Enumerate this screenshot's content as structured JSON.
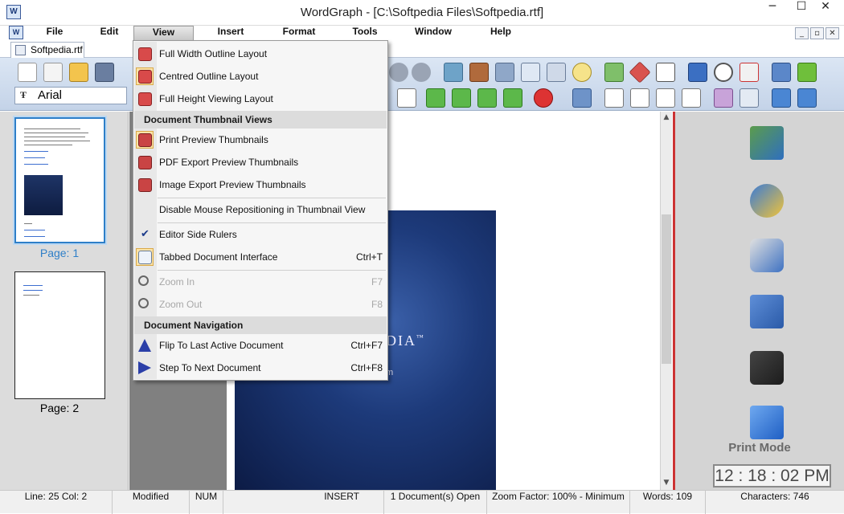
{
  "window": {
    "title": "WordGraph - [C:\\Softpedia Files\\Softpedia.rtf]",
    "min_glyph": "─",
    "max_glyph": "☐",
    "close_glyph": "✕"
  },
  "menubar": {
    "items": [
      "File",
      "Edit",
      "View",
      "Insert",
      "Format",
      "Tools",
      "Window",
      "Help"
    ],
    "active": "View"
  },
  "mdi_buttons": [
    "_",
    "▫",
    "✕"
  ],
  "tab": {
    "label": "Softpedia.rtf"
  },
  "font_box": {
    "value": "Arial",
    "icon_glyph": "Ŧ"
  },
  "thumbnails": [
    {
      "label": "Page: 1",
      "selected": true
    },
    {
      "label": "Page: 2",
      "selected": false
    }
  ],
  "view_menu": {
    "items": [
      {
        "label": "Full Width Outline Layout",
        "shortcut": ""
      },
      {
        "label": "Centred Outline Layout",
        "shortcut": ""
      },
      {
        "label": "Full Height Viewing Layout",
        "shortcut": ""
      }
    ],
    "header_thumbnails": "Document Thumbnail Views",
    "thumbnail_items": [
      {
        "label": "Print Preview Thumbnails",
        "shortcut": ""
      },
      {
        "label": "PDF Export Preview Thumbnails",
        "shortcut": ""
      },
      {
        "label": "Image Export Preview Thumbnails",
        "shortcut": ""
      }
    ],
    "disable_mouse": "Disable Mouse Repositioning in Thumbnail View",
    "editor_rulers": "Editor Side Rulers",
    "tabbed": {
      "label": "Tabbed Document Interface",
      "shortcut": "Ctrl+T"
    },
    "zoom_in": {
      "label": "Zoom In",
      "shortcut": "F7"
    },
    "zoom_out": {
      "label": "Zoom Out",
      "shortcut": "F8"
    },
    "header_navigation": "Document Navigation",
    "flip": {
      "label": "Flip To Last Active Document",
      "shortcut": "Ctrl+F7"
    },
    "step": {
      "label": "Step To Next Document",
      "shortcut": "Ctrl+F8"
    },
    "check_glyph": "✔"
  },
  "cover": {
    "title": "DIA",
    "tm": "™",
    "url_fragment": "m"
  },
  "scroll": {
    "up": "▲",
    "down": "▼"
  },
  "right_panel": {
    "print_mode": "Print Mode",
    "clock": "12 : 18 : 02  PM"
  },
  "status": {
    "line": "Line:  25  Col:   2",
    "modified": "Modified",
    "num": "NUM",
    "insert": "INSERT",
    "docs_open": "1 Document(s) Open",
    "zoom": "Zoom Factor: 100% - Minimum",
    "words": "Words: 109",
    "characters": "Characters: 746"
  },
  "colors": {
    "accent": "#2e7fc8",
    "toolbar": "#c4d3e8",
    "red_border": "#cc3333"
  }
}
